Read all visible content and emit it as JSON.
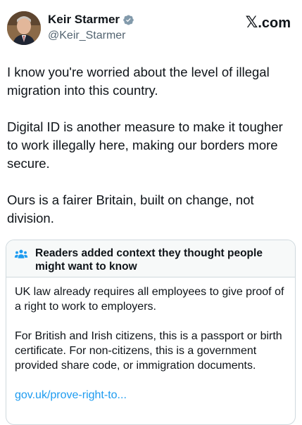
{
  "author": {
    "display_name": "Keir Starmer",
    "handle": "@Keir_Starmer",
    "verified": true
  },
  "brand": {
    "x_glyph": "𝕏",
    "label": ".com"
  },
  "tweet": {
    "paragraphs": [
      "I know you're worried about the level of illegal migration into this country.",
      "Digital ID is another measure to make it tougher to work illegally here, making our borders more secure.",
      "Ours is a fairer Britain, built on change, not division."
    ]
  },
  "community_note": {
    "title": "Readers added context they thought people might want to know",
    "paragraphs": [
      "UK law already requires all employees to give proof of a right to work to employers.",
      "For British and Irish citizens, this is a passport or birth certificate. For non-citizens, this is a government provided share code, or immigration documents."
    ],
    "link_text": "gov.uk/prove-right-to..."
  },
  "colors": {
    "text": "#0f1419",
    "muted": "#536471",
    "accent": "#1d9bf0",
    "note_header_bg": "#f7f9f9",
    "border": "#cfd9de"
  }
}
